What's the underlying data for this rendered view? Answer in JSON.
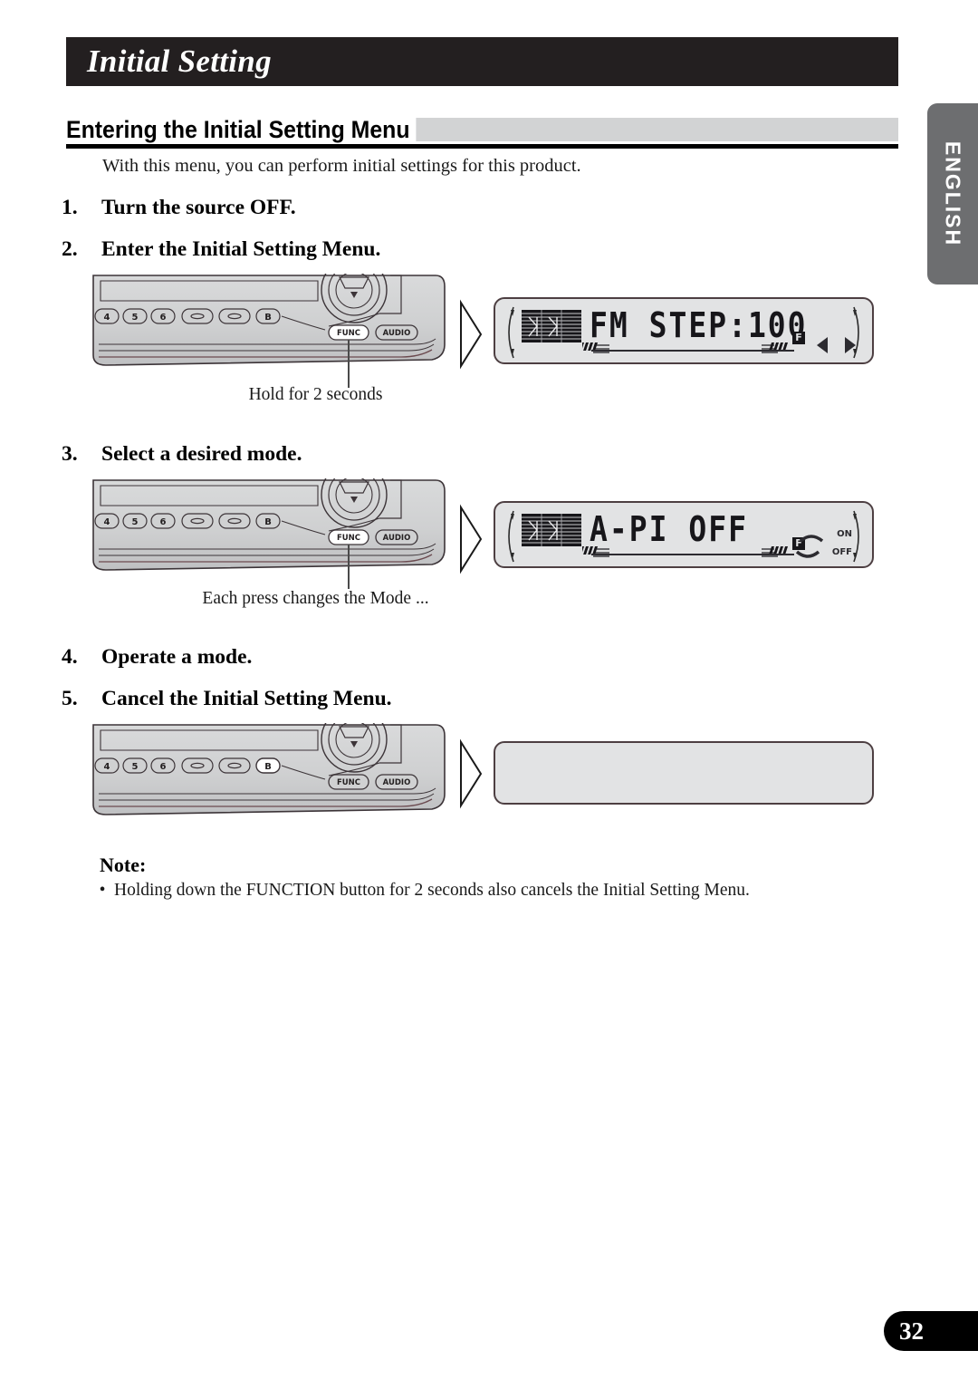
{
  "page": {
    "title": "Initial Setting",
    "number": "32",
    "language_tab": "ENGLISH"
  },
  "section": {
    "heading": "Entering the Initial Setting Menu",
    "intro": "With this menu, you can perform initial settings for this product."
  },
  "steps": [
    {
      "num": "1.",
      "label": "Turn the source OFF."
    },
    {
      "num": "2.",
      "label": "Enter the Initial Setting Menu."
    },
    {
      "num": "3.",
      "label": "Select a desired mode."
    },
    {
      "num": "4.",
      "label": "Operate a mode."
    },
    {
      "num": "5.",
      "label": "Cancel the Initial Setting Menu."
    }
  ],
  "callouts": {
    "hold_2_seconds": "Hold for 2 seconds",
    "each_press": "Each press changes the Mode ..."
  },
  "device_buttons": {
    "preset_4": "4",
    "preset_5": "5",
    "preset_6": "6",
    "band": "B",
    "func": "FUNC",
    "audio": "AUDIO"
  },
  "lcd": [
    {
      "text": "FM STEP:100",
      "f_indicator": "F",
      "left_arrow": "◀",
      "right_arrow": "▶"
    },
    {
      "text": "A-PI OFF",
      "f_indicator": "F",
      "on_label": "ON",
      "off_label": "OFF"
    },
    {
      "text": ""
    }
  ],
  "note": {
    "title": "Note:",
    "bullet_mark": "•",
    "items": [
      "Holding down the FUNCTION button for 2 seconds also cancels the Initial Setting Menu."
    ]
  },
  "colors": {
    "title_bar": "#231f20",
    "heading_band": "#d2d3d4",
    "lcd_bg": "#e2e3e4",
    "lcd_border": "#4d3f42",
    "side_tab": "#6d6e70"
  }
}
